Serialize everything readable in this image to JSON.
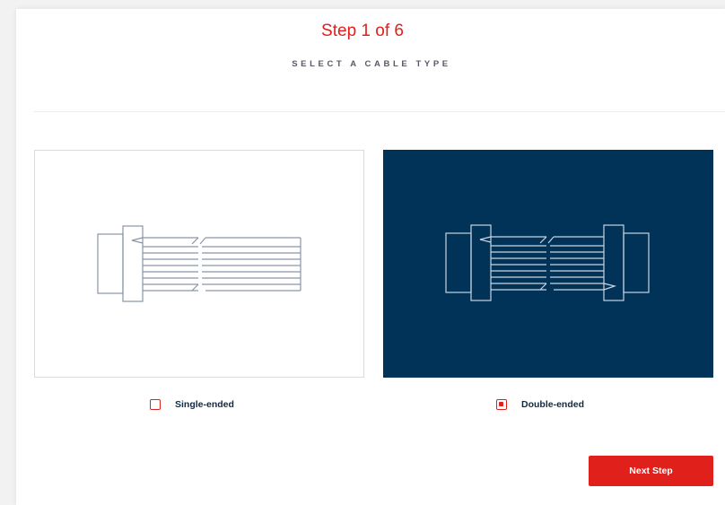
{
  "wizard": {
    "step_label": "Step 1 of 6",
    "subtitle": "SELECT A CABLE TYPE"
  },
  "options": [
    {
      "label": "Single-ended",
      "selected": false,
      "icon": "single-ended-cable-icon"
    },
    {
      "label": "Double-ended",
      "selected": true,
      "icon": "double-ended-cable-icon"
    }
  ],
  "actions": {
    "next_label": "Next Step"
  },
  "colors": {
    "accent": "#e0201b",
    "selected_card_bg": "#003357",
    "text_dark": "#0f2a45"
  }
}
